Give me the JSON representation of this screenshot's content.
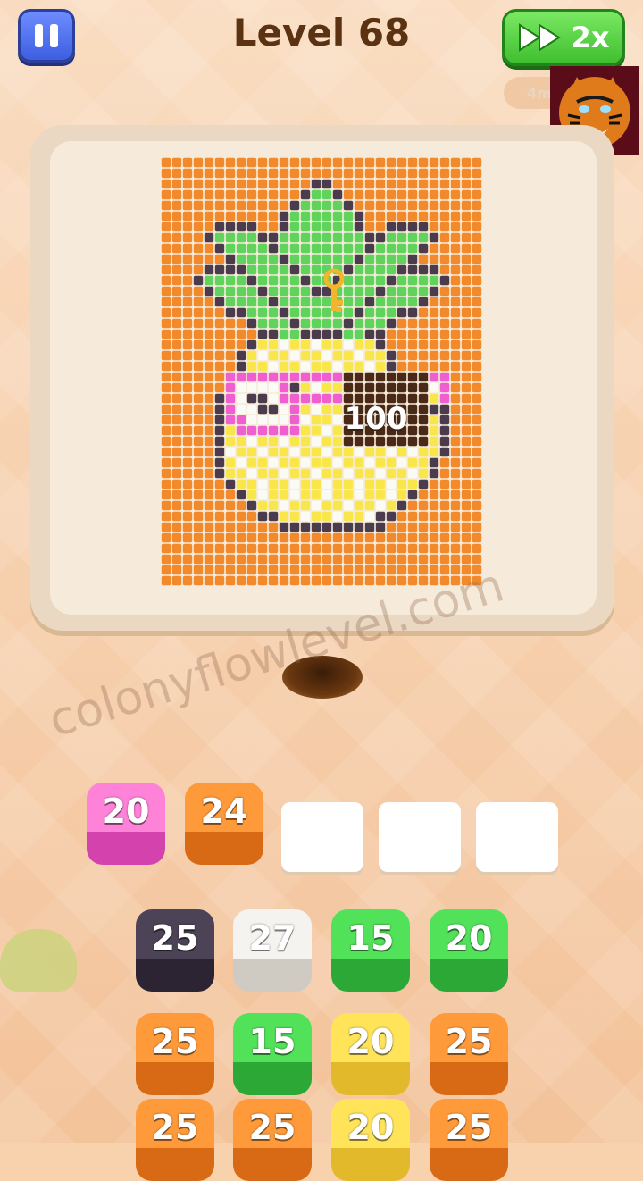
{
  "header": {
    "level_title": "Level 68",
    "speed_label": "2x",
    "timer_text": "4m"
  },
  "board": {
    "counter_text": "100",
    "palette": {
      "O": "#f28a2c",
      "G": "#5fd35c",
      "D": "#4a3b4d",
      "W": "#fbfbf6",
      "Y": "#f8e64a",
      "P": "#ef5fcf",
      "B": "#4a2a16"
    },
    "pixels": [
      "OOOOOOOOOOOOOOOOOOOOOOOOOOOOOO",
      "OOOOOOOOOOOOOOOOOOOOOOOOOOOOOO",
      "OOOOOOOOOOOOOODDOOOOOOOOOOOOOO",
      "OOOOOOOOOOOOODGGDOOOOOOOOOOOOO",
      "OOOOOOOOOOOODGGGGDOOOOOOOOOOOO",
      "OOOOOOOOOOODGGGGGGDOOOOOOOOOOO",
      "OOOOODDDDOODGGGGGGDOODDDDOOOOO",
      "OOOODGGGGDDGGGGGGGGDDGGGGDOOOO",
      "OOOOODGGGGDGGGGGGGGDGGGGDOOOOO",
      "OOOOOODGGGGDGGGGGGDGGGGDOOOOOO",
      "OOOODDDDGGGGDGGGGDGGGGDDDDOOOO",
      "OOODGGGGDGGGGDGGDGGGGDGGGGDOOO",
      "OOOODGGGGDGGGGDDGGGGDGGGGDOOOO",
      "OOOOODGGGGDGGGGGGGGDGGGGDOOOOO",
      "OOOOOODDGGGDGGGGGGDGGGDDOOOOOO",
      "OOOOOOOODGGGDGGGGDGGGDOOOOOOOO",
      "OOOOOOOOODDGGDDDDGGDDOOOOOOOOO",
      "OOOOOOOODYYWYYWYYWYYDOOOOOOOOO",
      "OOOOOOODYWYYWYYWYYWYYDOOOOOOOO",
      "OOOOOOODYYWYYWYYWYYWYDOOOOOOOO",
      "OOOOOOPPPPPPPPPPPBBBBBBBBPPOOO",
      "OOOOOOPWWWWPDYWYYBBBBBBBBWPOOO",
      "OOOOODPWDDWPPPPPPBBBBBBBBYPOOO",
      "OOOOODPWWDDWPYWYYBBBBBBBBDDOOO",
      "OOOOODPPWWWWPWYYWBBBBBBBBYDOOO",
      "OOOOODYPPPPPPYYWYBBBBBBBBYDOOO",
      "OOOOODYYWYYWYYWYYBBBBBBBBYDOOO",
      "OOOOODWYYWYYWYYWYYWYYWYWYYDOOO",
      "OOOOODYWYYWYYWYYWYYWYYWYYDOOOO",
      "OOOOODYYWYYWYYWYYWYYWYYWYDOOOO",
      "OOOOOODYYWYYWYYWYYWYYWYYDOOOOO",
      "OOOOOOODYWYYWYYWYYWYYWYDOOOOOO",
      "OOOOOOOODYYWYYWYYWYYWYDOOOOOOO",
      "OOOOOOOOODDYYWYYWYYWDDOOOOOOOO",
      "OOOOOOOOOOODDDDDDDDDDOOOOOOOOO",
      "OOOOOOOOOOOOOOOOOOOOOOOOOOOOOO",
      "OOOOOOOOOOOOOOOOOOOOOOOOOOOOOO",
      "OOOOOOOOOOOOOOOOOOOOOOOOOOOOOO",
      "OOOOOOOOOOOOOOOOOOOOOOOOOOOOOO",
      "OOOOOOOOOOOOOOOOOOOOOOOOOOOOOO"
    ]
  },
  "watermark": "colonyflowlevel.com",
  "queue": [
    {
      "value": "20",
      "color": "pink"
    },
    {
      "value": "24",
      "color": "orange"
    }
  ],
  "empty_slots": 3,
  "rows": [
    [
      {
        "value": "25",
        "color": "dark"
      },
      {
        "value": "27",
        "color": "white"
      },
      {
        "value": "15",
        "color": "green"
      },
      {
        "value": "20",
        "color": "green"
      }
    ],
    [
      {
        "value": "25",
        "color": "orange"
      },
      {
        "value": "15",
        "color": "green"
      },
      {
        "value": "20",
        "color": "yellow"
      },
      {
        "value": "25",
        "color": "orange"
      }
    ],
    [
      {
        "value": "25",
        "color": "orange"
      },
      {
        "value": "25",
        "color": "orange"
      },
      {
        "value": "20",
        "color": "yellow"
      },
      {
        "value": "25",
        "color": "orange"
      }
    ]
  ]
}
